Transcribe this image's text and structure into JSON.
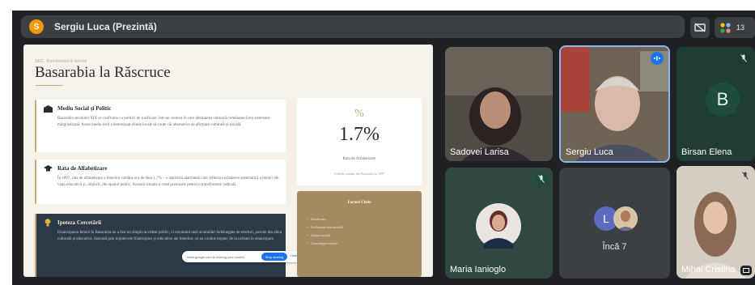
{
  "presenter_bar": {
    "avatar_letter": "S",
    "label": "Sergiu Luca (Prezintă)"
  },
  "toolbar": {
    "people_count": "13"
  },
  "slide": {
    "kicker": "SEC. Românească Istorie",
    "title": "Basarabia la Răscruce",
    "card1": {
      "title": "Mediu Social și Politic",
      "text": "Basarabia secolului XIX se confrunta cu politici de rusificare, într-un context în care identitatea culturală românească era sistematic marginalizată. Acest mediu ostil a determinat elitele locale să caute căi alternative de afirmare culturală și socială."
    },
    "card2": {
      "title": "Rata de Alfabetizare",
      "text": "În 1897, rata de alfabetizare a femeilor române era de doar 1,7% – o statistică alarmantă care reflecta excluderea sistematică a femeii din viața educativă și, implicit, din spațiul public. Această situație a creat premisele pentru o transformare radicală."
    },
    "card3": {
      "title": "Ipoteza Cercetării",
      "text": "Emanciparea femeii în Basarabia nu a fost un simplu accident politic, ci rezultatul unei acumulări îndelungate de eforturi, pornite din sfera culturală și educativă, ilustrată prin inițiativele filantropice și educative ale femeilor, ce au condus treptat, de la caritate la emancipare."
    },
    "share_notice": {
      "text": "meet.google.com is sharing your screen.",
      "stop_label": "Stop sharing",
      "hide_label": "Hide"
    },
    "stat": {
      "symbol": "%",
      "value": "1.7%",
      "label": "Rata de Alfabetizare",
      "sub": "Femeile române din Basarabia în 1897"
    },
    "factors": {
      "title": "Factori Cheie",
      "items": [
        "Rusificarea",
        "Excluziune educațională",
        "Izolare socială",
        "Constrângeri morale"
      ]
    }
  },
  "participants": {
    "p1": {
      "name": "Sadovei Larisa"
    },
    "p2": {
      "name": "Sergiu Luca"
    },
    "p3": {
      "name": "Birsan Elena",
      "initial": "B"
    },
    "p4": {
      "name": "Maria Ianioglo"
    },
    "p5": {
      "name": "Încă 7",
      "initial": "L"
    },
    "p6": {
      "name": "Mihai Cristina"
    }
  },
  "colors": {
    "meet_bg": "#202124",
    "tile_bg": "#3c4043",
    "active_speaker": "#8ab4f8",
    "accent_gold": "#c9a96e",
    "presenter_avatar": "#f29900"
  },
  "icons": {
    "presenter_bar": "presenter-avatar",
    "toolbar_1": "stop-presenting-icon",
    "toolbar_2": "people-icon",
    "muted": "mic-off-icon",
    "speaking": "audio-level-icon"
  }
}
